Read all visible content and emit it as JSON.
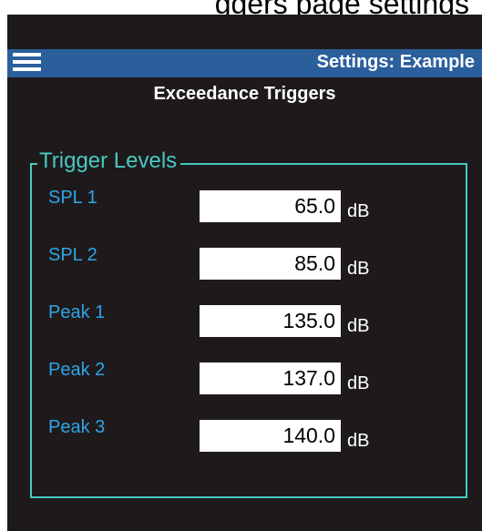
{
  "caption": "ggers page settings",
  "header": {
    "title": "Settings: Example",
    "menu_icon": "hamburger-menu-icon"
  },
  "page": {
    "subtitle": "Exceedance Triggers"
  },
  "trigger_levels": {
    "group_title": "Trigger Levels",
    "rows": [
      {
        "label": "SPL 1",
        "value": "65.0",
        "unit": "dB"
      },
      {
        "label": "SPL 2",
        "value": "85.0",
        "unit": "dB"
      },
      {
        "label": "Peak 1",
        "value": "135.0",
        "unit": "dB"
      },
      {
        "label": "Peak 2",
        "value": "137.0",
        "unit": "dB"
      },
      {
        "label": "Peak 3",
        "value": "140.0",
        "unit": "dB"
      }
    ]
  },
  "colors": {
    "background": "#1e1a1b",
    "titlebar": "#2a5f9c",
    "groupbox_border": "#47c9c0",
    "label": "#2fa4e7"
  }
}
